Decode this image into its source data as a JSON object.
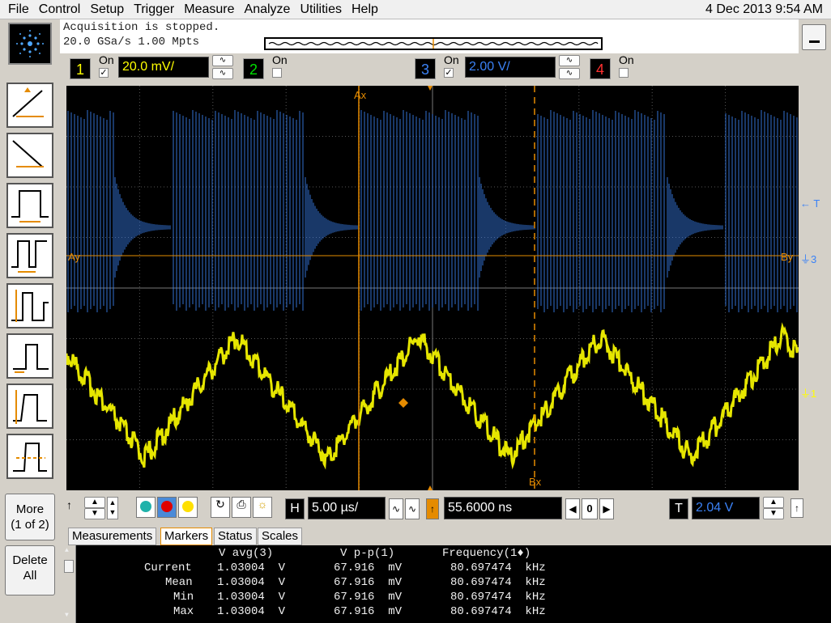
{
  "menu": {
    "items": [
      "File",
      "Control",
      "Setup",
      "Trigger",
      "Measure",
      "Analyze",
      "Utilities",
      "Help"
    ],
    "datetime": "4 Dec 2013  9:54 AM"
  },
  "status": {
    "line1": "Acquisition is stopped.",
    "line2": "20.0 GSa/s   1.00 Mpts"
  },
  "channels": [
    {
      "num": "1",
      "on_label": "On",
      "checked": true,
      "scale": "20.0 mV/",
      "color": "#ffff00"
    },
    {
      "num": "2",
      "on_label": "On",
      "checked": false,
      "color": "#00e000"
    },
    {
      "num": "3",
      "on_label": "On",
      "checked": true,
      "scale": "2.00 V/",
      "color": "#3b82f6"
    },
    {
      "num": "4",
      "on_label": "On",
      "checked": false,
      "color": "#ff3030"
    }
  ],
  "trigger_sidebar": {
    "items": [
      "rising-edge-trigger",
      "falling-edge-trigger",
      "pulse-width-trigger",
      "pulse-width-range-trigger",
      "runt-trigger",
      "setup-hold-trigger",
      "transition-trigger",
      "window-trigger"
    ]
  },
  "left_buttons": {
    "more_line1": "More",
    "more_line2": "(1 of 2)",
    "delete_line1": "Delete",
    "delete_line2": "All"
  },
  "markers": {
    "ax": "Ax",
    "bx": "Bx",
    "ay": "Ay",
    "by": "By",
    "color": "#e58b00"
  },
  "right_axis": {
    "t_label": "T",
    "ch3_label": "3",
    "ch1_label": "1"
  },
  "controls": {
    "horizontal_label": "H",
    "timebase": "5.00 µs/",
    "delay": "55.6000 ns",
    "zoom_value": "0",
    "trigger_label": "T",
    "trigger_level": "2.04 V"
  },
  "tabs": [
    "Measurements",
    "Markers",
    "Status",
    "Scales"
  ],
  "active_tab": "Markers",
  "measurements": {
    "headers": [
      "V avg(3)",
      "V p-p(1)",
      "Frequency(1♦)"
    ],
    "rows": [
      {
        "label": "Current",
        "vavg": "1.03004  V",
        "vpp": "67.916  mV",
        "freq": "80.697474  kHz"
      },
      {
        "label": "Mean",
        "vavg": "1.03004  V",
        "vpp": "67.916  mV",
        "freq": "80.697474  kHz"
      },
      {
        "label": "Min",
        "vavg": "1.03004  V",
        "vpp": "67.916  mV",
        "freq": "80.697474  kHz"
      },
      {
        "label": "Max",
        "vavg": "1.03004  V",
        "vpp": "67.916  mV",
        "freq": "80.697474  kHz"
      }
    ]
  },
  "colors": {
    "ch1": "#ffff00",
    "ch3": "#3b82f6",
    "marker": "#e58b00",
    "grid": "#555555"
  }
}
